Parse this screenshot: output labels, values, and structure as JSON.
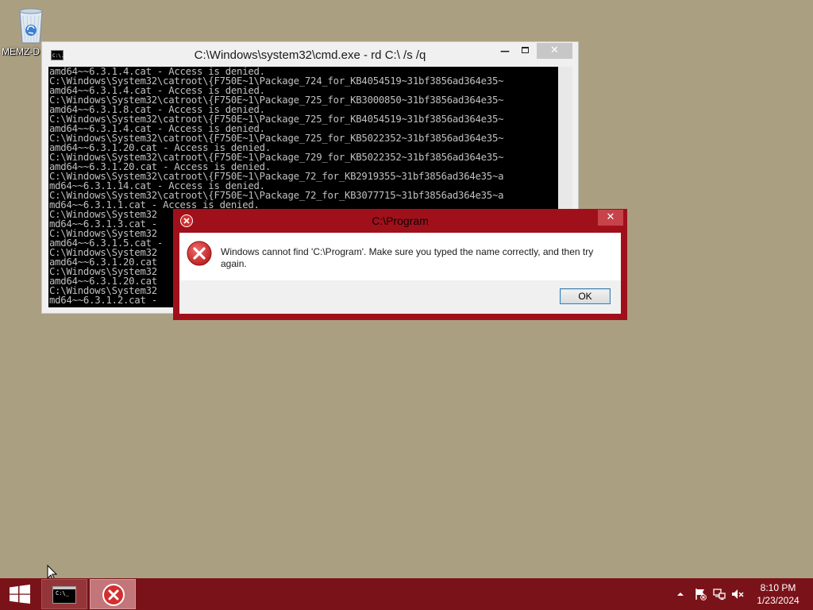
{
  "desktop": {
    "background_color": "#ab9f82",
    "icons": [
      {
        "label": "MEMZ-D",
        "icon": "recycle-bin-icon"
      }
    ]
  },
  "cmd_window": {
    "title": "C:\\Windows\\system32\\cmd.exe - rd  C:\\ /s /q",
    "app_icon_text": "C:\\.",
    "buttons": {
      "minimize": "—",
      "maximize": "maximize",
      "close": "✕"
    },
    "console_lines": [
      "amd64~~6.3.1.4.cat - Access is denied.",
      "C:\\Windows\\System32\\catroot\\{F750E~1\\Package_724_for_KB4054519~31bf3856ad364e35~",
      "amd64~~6.3.1.4.cat - Access is denied.",
      "C:\\Windows\\System32\\catroot\\{F750E~1\\Package_725_for_KB3000850~31bf3856ad364e35~",
      "amd64~~6.3.1.8.cat - Access is denied.",
      "C:\\Windows\\System32\\catroot\\{F750E~1\\Package_725_for_KB4054519~31bf3856ad364e35~",
      "amd64~~6.3.1.4.cat - Access is denied.",
      "C:\\Windows\\System32\\catroot\\{F750E~1\\Package_725_for_KB5022352~31bf3856ad364e35~",
      "amd64~~6.3.1.20.cat - Access is denied.",
      "C:\\Windows\\System32\\catroot\\{F750E~1\\Package_729_for_KB5022352~31bf3856ad364e35~",
      "amd64~~6.3.1.20.cat - Access is denied.",
      "C:\\Windows\\System32\\catroot\\{F750E~1\\Package_72_for_KB2919355~31bf3856ad364e35~a",
      "md64~~6.3.1.14.cat - Access is denied.",
      "C:\\Windows\\System32\\catroot\\{F750E~1\\Package_72_for_KB3077715~31bf3856ad364e35~a",
      "md64~~6.3.1.1.cat - Access is denied.",
      "C:\\Windows\\System32",
      "md64~~6.3.1.3.cat -",
      "C:\\Windows\\System32",
      "amd64~~6.3.1.5.cat -",
      "C:\\Windows\\System32",
      "amd64~~6.3.1.20.cat",
      "C:\\Windows\\System32",
      "amd64~~6.3.1.20.cat",
      "C:\\Windows\\System32",
      "md64~~6.3.1.2.cat -"
    ]
  },
  "error_dialog": {
    "title": "C:\\Program",
    "title_icon": "error-icon",
    "close_label": "✕",
    "message": "Windows cannot find 'C:\\Program'. Make sure you typed the name correctly, and then try again.",
    "message_icon": "error-icon",
    "ok_label": "OK",
    "frame_color": "#a0101b"
  },
  "taskbar": {
    "color": "#7a1319",
    "start_icon": "windows-logo-icon",
    "tasks": [
      {
        "name": "cmd.exe",
        "icon": "command-prompt-icon",
        "glyph_text": "C:\\_",
        "state": "open"
      },
      {
        "name": "C:\\Program",
        "icon": "error-icon",
        "state": "active"
      }
    ],
    "tray": {
      "icons": [
        "show-hidden-icons-chevron",
        "action-center-flag-icon",
        "network-icon",
        "volume-muted-icon"
      ],
      "time": "8:10 PM",
      "date": "1/23/2024"
    }
  }
}
